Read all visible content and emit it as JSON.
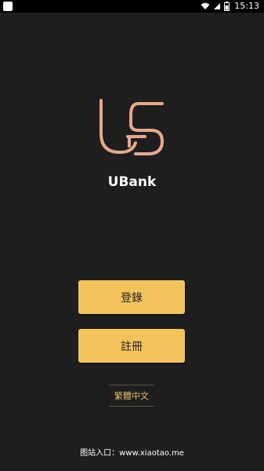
{
  "status_bar": {
    "time": "15:13",
    "icons": [
      "app-notification-icon",
      "wifi-icon",
      "signal-icon",
      "battery-icon"
    ]
  },
  "app": {
    "logo": "UBank logo",
    "name": "UBank"
  },
  "buttons": {
    "login_label": "登錄",
    "register_label": "註冊"
  },
  "language": {
    "label": "繁體中文"
  },
  "footer": {
    "text": "图站入口：www.xiaotao.me"
  },
  "colors": {
    "background": "#1e1e1e",
    "button": "#f2c45b",
    "logo": "#e8a98a",
    "language_text": "#e3bd62"
  }
}
